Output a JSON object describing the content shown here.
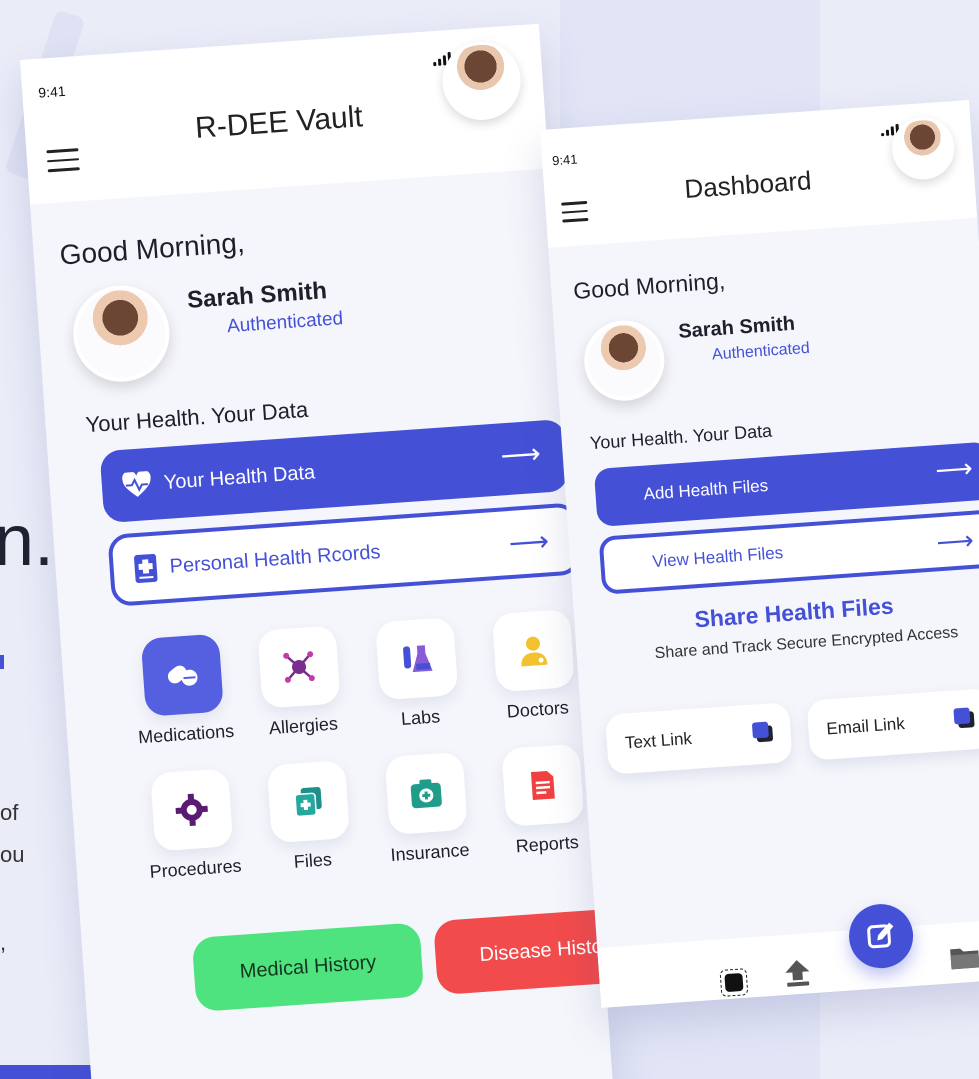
{
  "background": {
    "partial_heading": "n.",
    "partial_lines": [
      "of",
      "ou",
      ","
    ]
  },
  "vault_screen": {
    "time": "9:41",
    "title": "R-DEE Vault",
    "greeting": "Good Morning,",
    "user_name": "Sarah Smith",
    "user_status": "Authenticated",
    "tagline": "Your Health. Your Data",
    "primary_cta": "Your Health Data",
    "secondary_cta": "Personal Health Rcords",
    "tiles": [
      {
        "label": "Medications",
        "icon": "pills-icon"
      },
      {
        "label": "Allergies",
        "icon": "allergen-icon"
      },
      {
        "label": "Labs",
        "icon": "flask-icon"
      },
      {
        "label": "Doctors",
        "icon": "doctor-icon"
      },
      {
        "label": "Procedures",
        "icon": "gear-icon"
      },
      {
        "label": "Files",
        "icon": "files-icon"
      },
      {
        "label": "Insurance",
        "icon": "insurance-icon"
      },
      {
        "label": "Reports",
        "icon": "report-icon"
      }
    ],
    "medical_history": "Medical History",
    "disease_history": "Disease History"
  },
  "dashboard_screen": {
    "time": "9:41",
    "title": "Dashboard",
    "greeting": "Good Morning,",
    "user_name": "Sarah Smith",
    "user_status": "Authenticated",
    "tagline": "Your Health. Your Data",
    "add_files": "Add Health Files",
    "view_files": "View Health Files",
    "share_title": "Share Health Files",
    "share_subtitle": "Share and Track Secure Encrypted Access",
    "text_link": "Text Link",
    "email_link": "Email Link"
  },
  "colors": {
    "accent": "#4451d6",
    "medical_history": "#4ee37e",
    "disease_history": "#f24b4b"
  }
}
